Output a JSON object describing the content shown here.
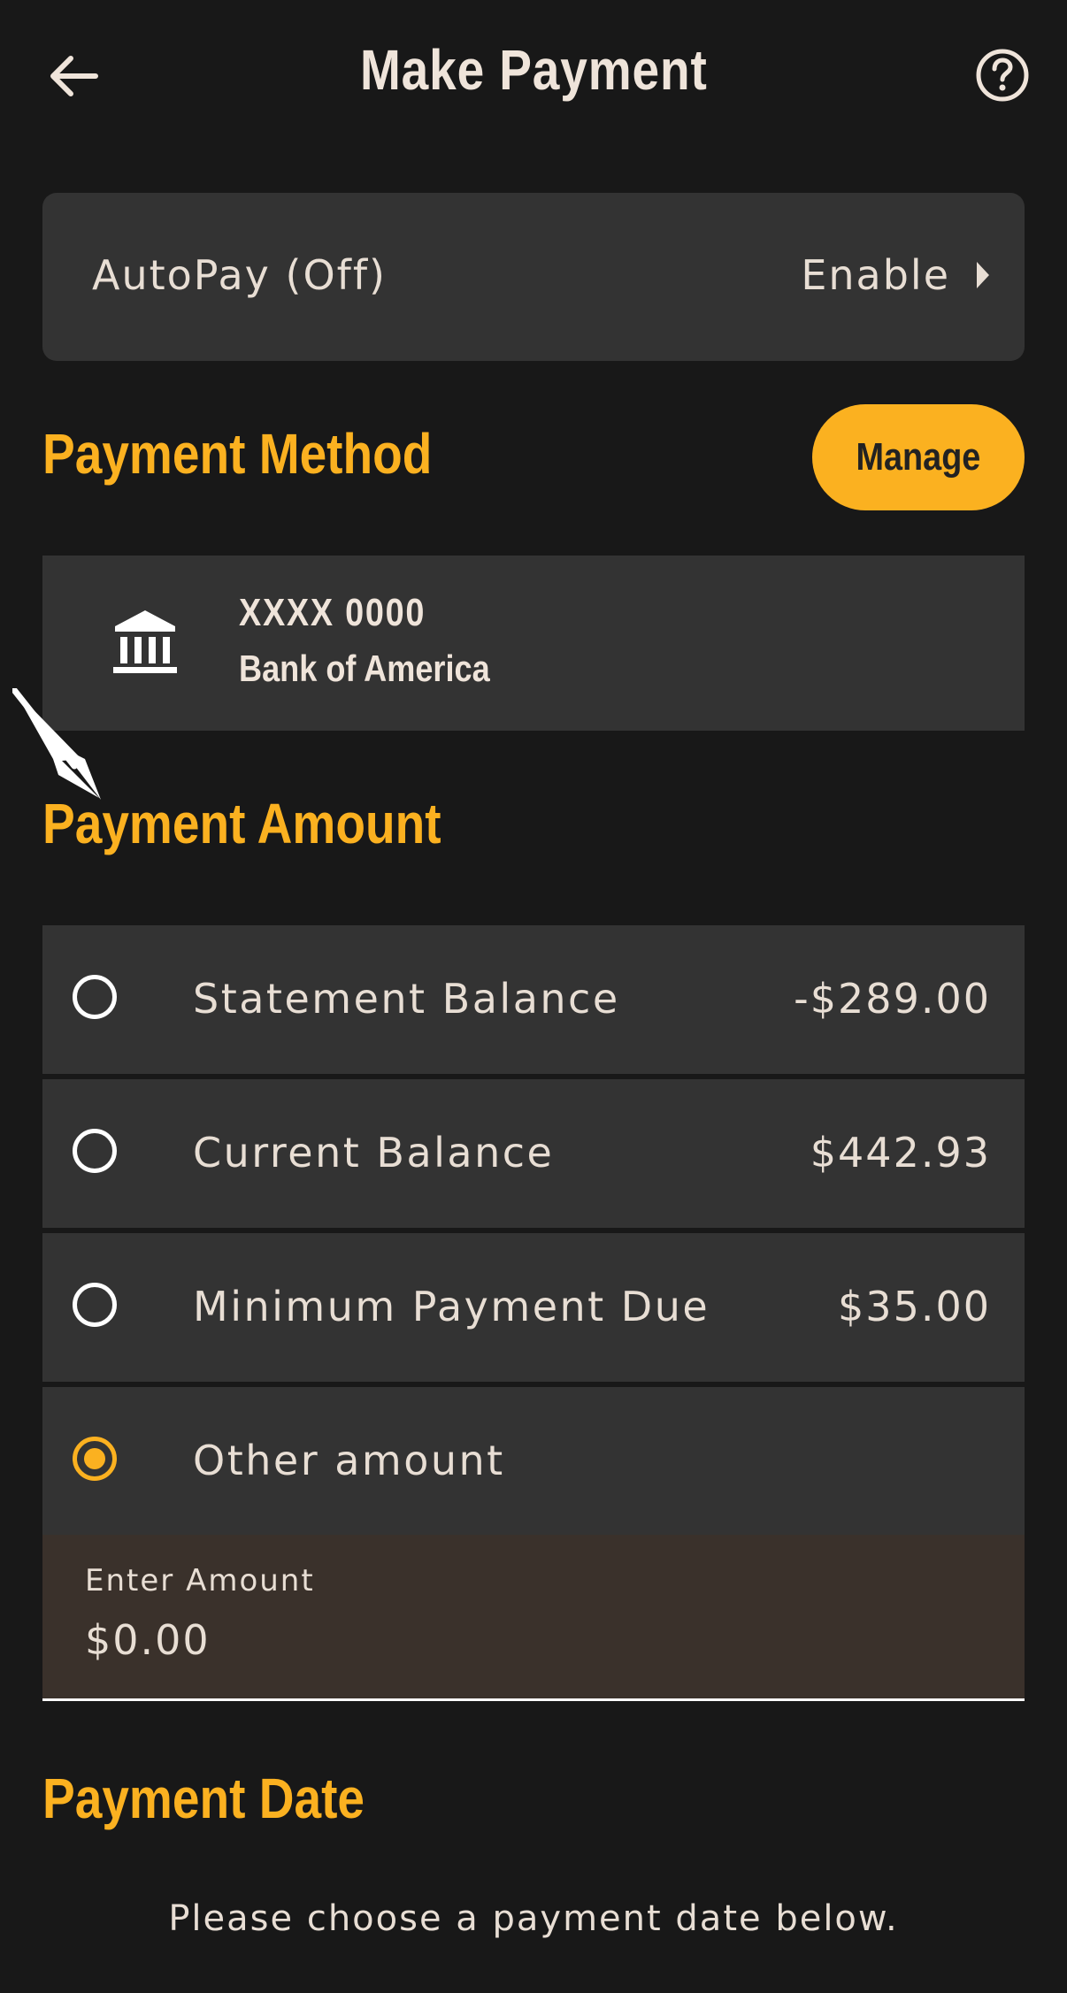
{
  "header": {
    "title": "Make Payment",
    "back_icon": "arrow-left-icon",
    "help_icon": "question-circle-icon"
  },
  "autopay": {
    "label": "AutoPay (Off)",
    "action": "Enable",
    "action_icon": "caret-right-icon"
  },
  "payment_method": {
    "heading": "Payment Method",
    "manage_label": "Manage",
    "account": {
      "icon": "bank-icon",
      "number": "XXXX 0000",
      "bank_name": "Bank of America"
    }
  },
  "payment_amount": {
    "heading": "Payment Amount",
    "options": [
      {
        "label": "Statement Balance",
        "value": "-$289.00",
        "selected": false
      },
      {
        "label": "Current Balance",
        "value": "$442.93",
        "selected": false
      },
      {
        "label": "Minimum Payment Due",
        "value": "$35.00",
        "selected": false
      },
      {
        "label": "Other amount",
        "value": "",
        "selected": true
      }
    ],
    "enter_amount": {
      "label": "Enter Amount",
      "value": "$0.00"
    }
  },
  "payment_date": {
    "heading": "Payment Date",
    "note": "Please choose a payment date below."
  },
  "colors": {
    "background": "#181818",
    "card": "#333333",
    "accent": "#fbb120",
    "input_bg": "#3a312b",
    "text": "#e8ded4"
  }
}
